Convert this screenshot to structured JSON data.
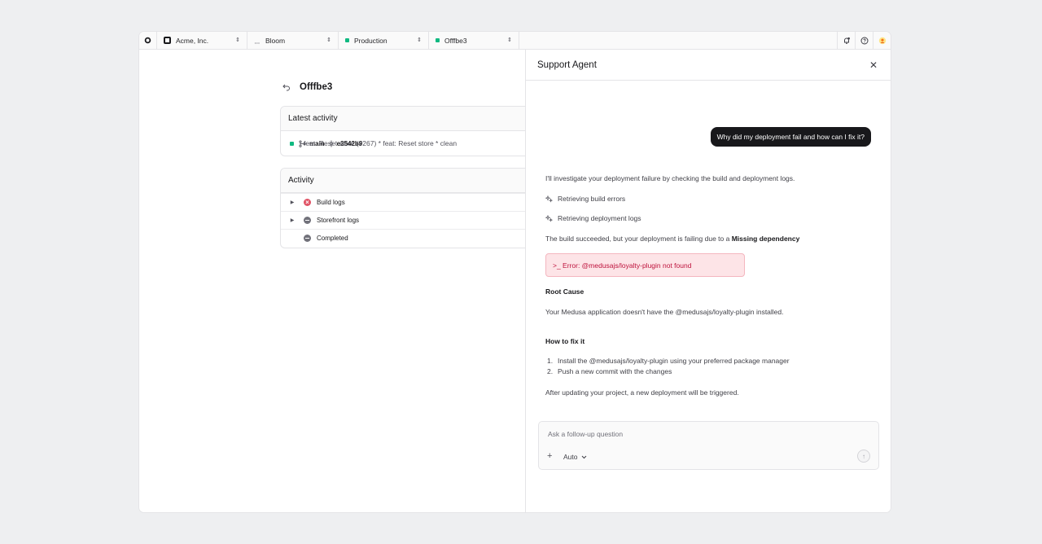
{
  "topbar": {
    "org": "Acme, Inc.",
    "project": "Bloom",
    "environment": "Production",
    "deployment": "Offfbe3"
  },
  "colors": {
    "accent_green": "#10b981",
    "error_red": "#e05365",
    "dark": "#18181b"
  },
  "main": {
    "title": "Offfbe3",
    "latest_activity": {
      "heading": "Latest activity",
      "branch": "main",
      "commit": "e3542b9",
      "separator": "·",
      "message": "feat: Reset store (#267) * feat: Reset store * clean"
    },
    "activity": {
      "heading": "Activity",
      "items": [
        {
          "label": "Build logs",
          "status": "error",
          "expandable": true
        },
        {
          "label": "Storefront logs",
          "status": "neutral",
          "expandable": true
        },
        {
          "label": "Completed",
          "status": "neutral",
          "expandable": false
        }
      ]
    }
  },
  "panel": {
    "title": "Support Agent",
    "user_message": "Why did my deployment fail and how can I fix it?",
    "intro": "I'll investigate your deployment failure by checking the build and deployment logs.",
    "tool1": "Retrieving build errors",
    "tool2": "Retrieving deployment logs",
    "finding_prefix": "The build succeeded, but your deployment is failing due to a",
    "finding_bold": "Missing dependency",
    "error_text": ">_ Error: @medusajs/loyalty-plugin not found",
    "root_cause_heading": "Root Cause",
    "root_cause_text": "Your Medusa application doesn't have the @medusajs/loyalty-plugin installed.",
    "fix_heading": "How to fix it",
    "steps": [
      {
        "n": "1.",
        "text": "Install the @medusajs/loyalty-plugin using your preferred package manager"
      },
      {
        "n": "2.",
        "text": "Push a new commit with the changes"
      }
    ],
    "closing": "After updating your project, a new deployment will be triggered.",
    "composer": {
      "placeholder": "Ask a follow-up question",
      "mode": "Auto"
    }
  }
}
